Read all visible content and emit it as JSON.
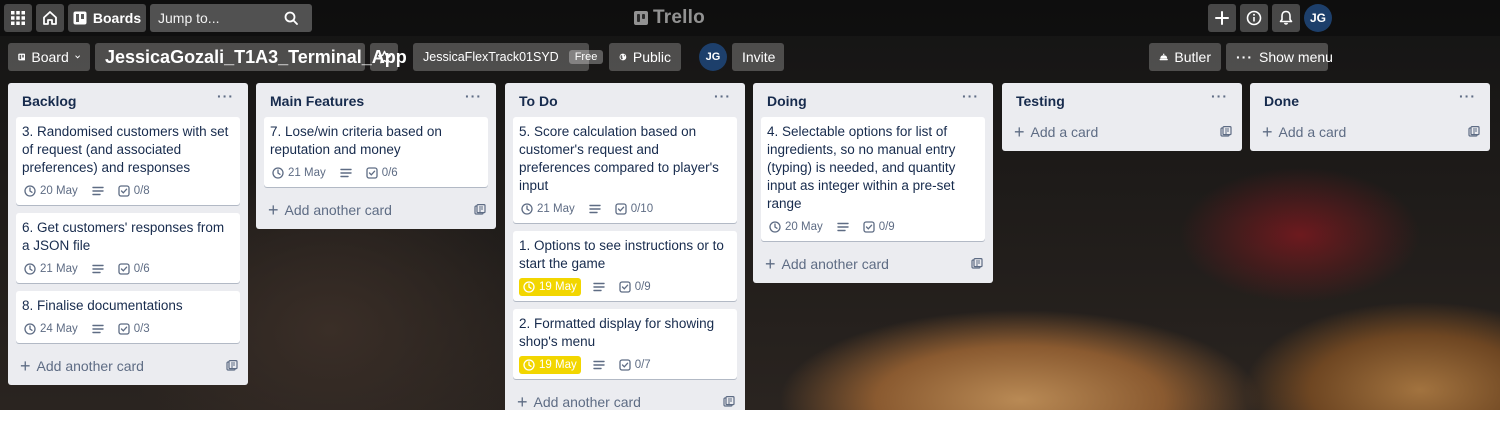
{
  "header": {
    "boards_label": "Boards",
    "search_placeholder": "Jump to...",
    "logo_text": "Trello",
    "user_initials": "JG"
  },
  "boardbar": {
    "view_label": "Board",
    "board_name": "JessicaGozali_T1A3_Terminal_App",
    "workspace_name": "JessicaFlexTrack01SYD",
    "workspace_badge": "Free",
    "visibility_label": "Public",
    "member_initials": "JG",
    "invite_label": "Invite",
    "butler_label": "Butler",
    "show_menu_label": "Show menu"
  },
  "lists": [
    {
      "title": "Backlog",
      "add_label": "Add another card",
      "cards": [
        {
          "title": "3. Randomised customers with set of request (and associated preferences) and responses",
          "due": "20 May",
          "checklist": "0/8"
        },
        {
          "title": "6. Get customers' responses from a JSON file",
          "due": "21 May",
          "checklist": "0/6"
        },
        {
          "title": "8. Finalise documentations",
          "due": "24 May",
          "checklist": "0/3"
        }
      ]
    },
    {
      "title": "Main Features",
      "add_label": "Add another card",
      "cards": [
        {
          "title": "7. Lose/win criteria based on reputation and money",
          "due": "21 May",
          "checklist": "0/6"
        }
      ]
    },
    {
      "title": "To Do",
      "add_label": "Add another card",
      "cards": [
        {
          "title": "5. Score calculation based on customer's request and preferences compared to player's input",
          "due": "21 May",
          "checklist": "0/10"
        },
        {
          "title": "1. Options to see instructions or to start the game",
          "due": "19 May",
          "checklist": "0/9"
        },
        {
          "title": "2. Formatted display for showing shop's menu",
          "due": "19 May",
          "checklist": "0/7"
        }
      ]
    },
    {
      "title": "Doing",
      "add_label": "Add another card",
      "cards": [
        {
          "title": "4. Selectable options for list of ingredients, so no manual entry (typing) is needed, and quantity input as integer within a pre-set range",
          "due": "20 May",
          "checklist": "0/9"
        }
      ]
    },
    {
      "title": "Testing",
      "add_label": "Add a card",
      "cards": []
    },
    {
      "title": "Done",
      "add_label": "Add a card",
      "cards": []
    }
  ],
  "colors": {
    "list_bg": "#ebecf0",
    "due_soon": "#f2d600",
    "avatar": "#1d3f6b"
  }
}
